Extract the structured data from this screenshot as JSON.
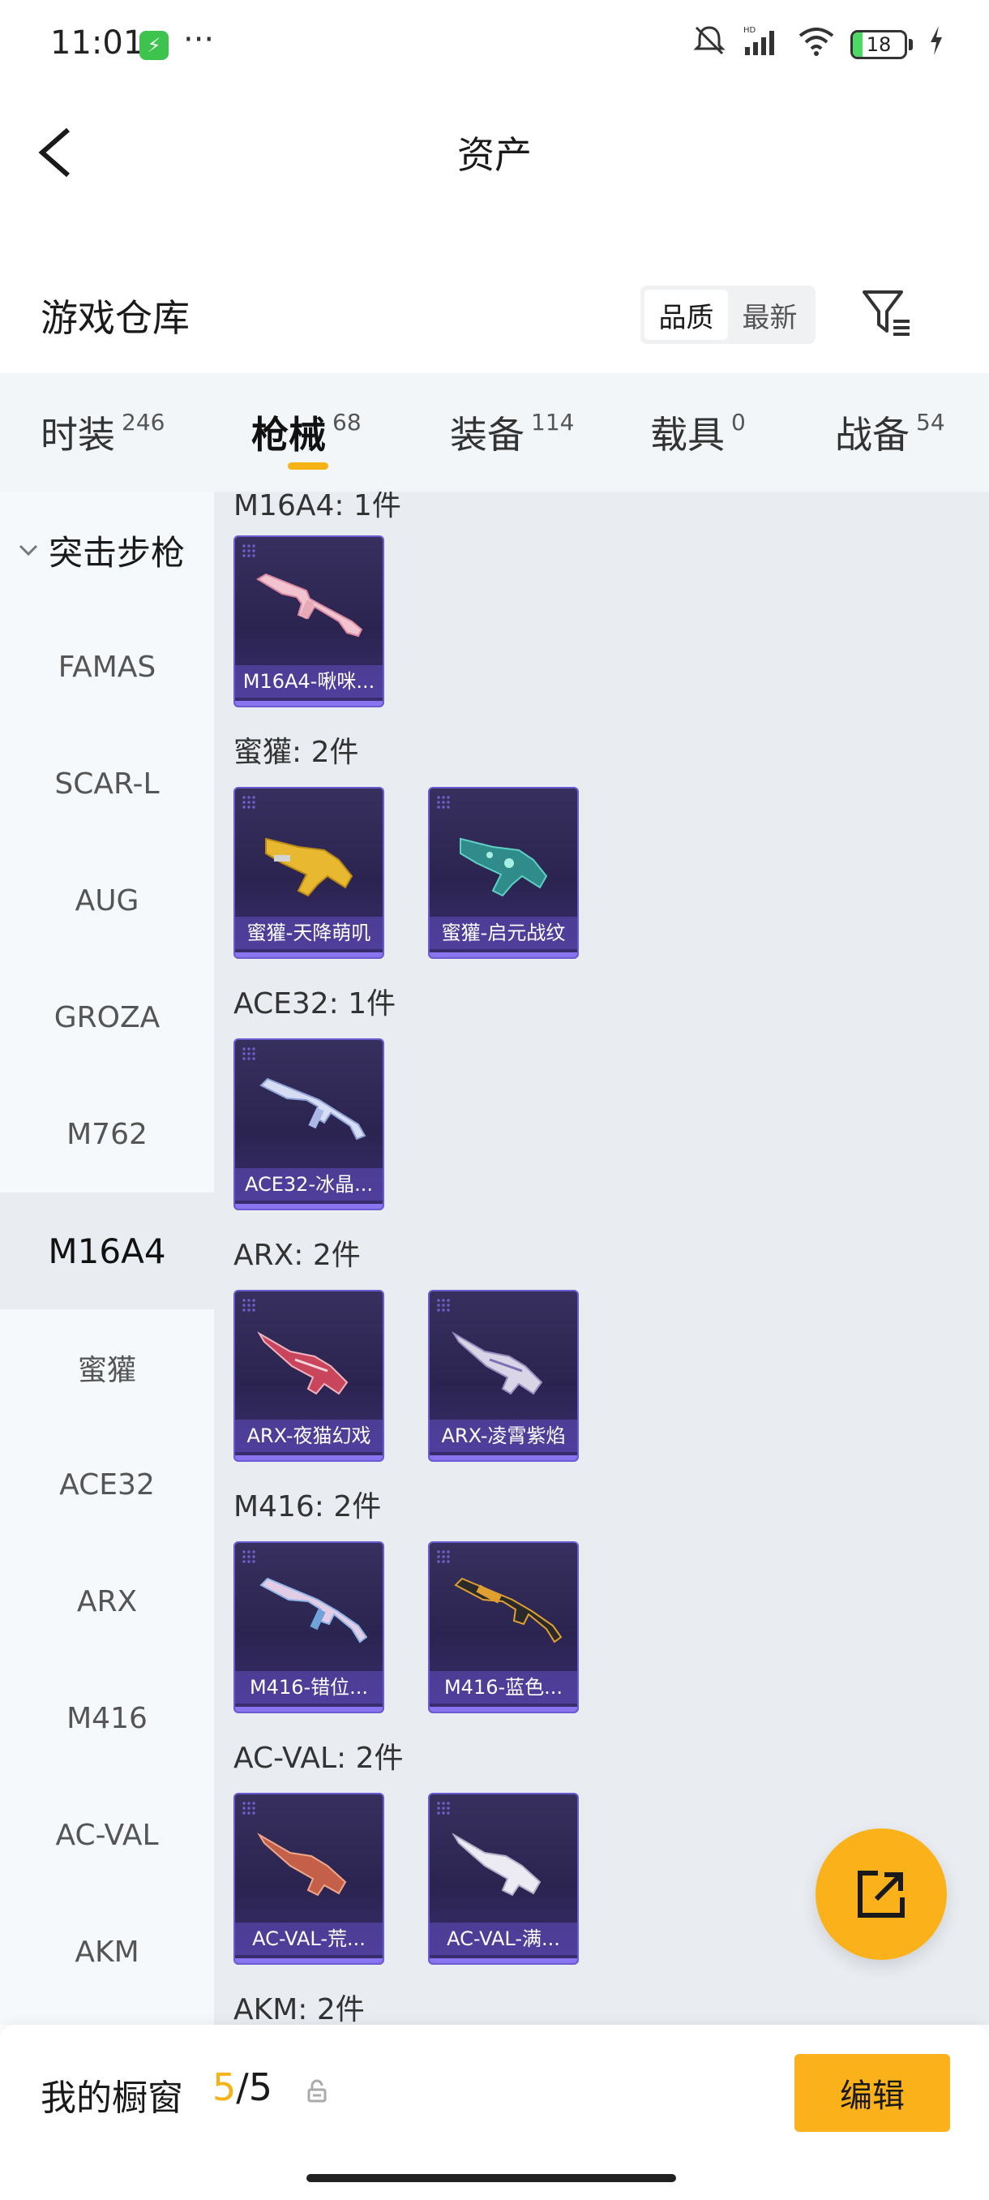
{
  "status_bar": {
    "time": "11:01",
    "dots": "···",
    "battery": "18",
    "icons": [
      "mute-icon",
      "hd-signal-icon",
      "wifi-icon",
      "battery-icon",
      "charging-icon"
    ]
  },
  "header": {
    "title": "资产"
  },
  "warehouse": {
    "title": "游戏仓库",
    "sort_options": [
      "品质",
      "最新"
    ],
    "active_sort": "品质"
  },
  "tabs": [
    {
      "label": "时装",
      "count": "246"
    },
    {
      "label": "枪械",
      "count": "68",
      "active": true
    },
    {
      "label": "装备",
      "count": "114"
    },
    {
      "label": "载具",
      "count": "0"
    },
    {
      "label": "战备",
      "count": "54"
    }
  ],
  "sidebar": {
    "group_label": "突击步枪",
    "items": [
      "FAMAS",
      "SCAR-L",
      "AUG",
      "GROZA",
      "M762",
      "M16A4",
      "蜜獾",
      "ACE32",
      "ARX",
      "M416",
      "AC-VAL",
      "AKM"
    ],
    "active_item": "M16A4"
  },
  "groups": [
    {
      "title": "M16A4: 1件",
      "items": [
        "M16A4-啾咪..."
      ]
    },
    {
      "title": "蜜獾: 2件",
      "items": [
        "蜜獾-天降萌叽",
        "蜜獾-启元战纹"
      ]
    },
    {
      "title": "ACE32: 1件",
      "items": [
        "ACE32-冰晶..."
      ]
    },
    {
      "title": "ARX: 2件",
      "items": [
        "ARX-夜猫幻戏",
        "ARX-凌霄紫焰"
      ]
    },
    {
      "title": "M416: 2件",
      "items": [
        "M416-错位...",
        "M416-蓝色..."
      ]
    },
    {
      "title": "AC-VAL: 2件",
      "items": [
        "AC-VAL-荒...",
        "AC-VAL-满..."
      ]
    },
    {
      "title": "AKM: 2件",
      "items": []
    }
  ],
  "showcase": {
    "label": "我的橱窗",
    "current": "5",
    "separator": "/",
    "total": "5",
    "edit_label": "编辑"
  },
  "colors": {
    "accent": "#fbb21a",
    "tab_underline": "#f5b316",
    "card_bg": "#2b2450",
    "card_border": "#6b5bd0"
  }
}
